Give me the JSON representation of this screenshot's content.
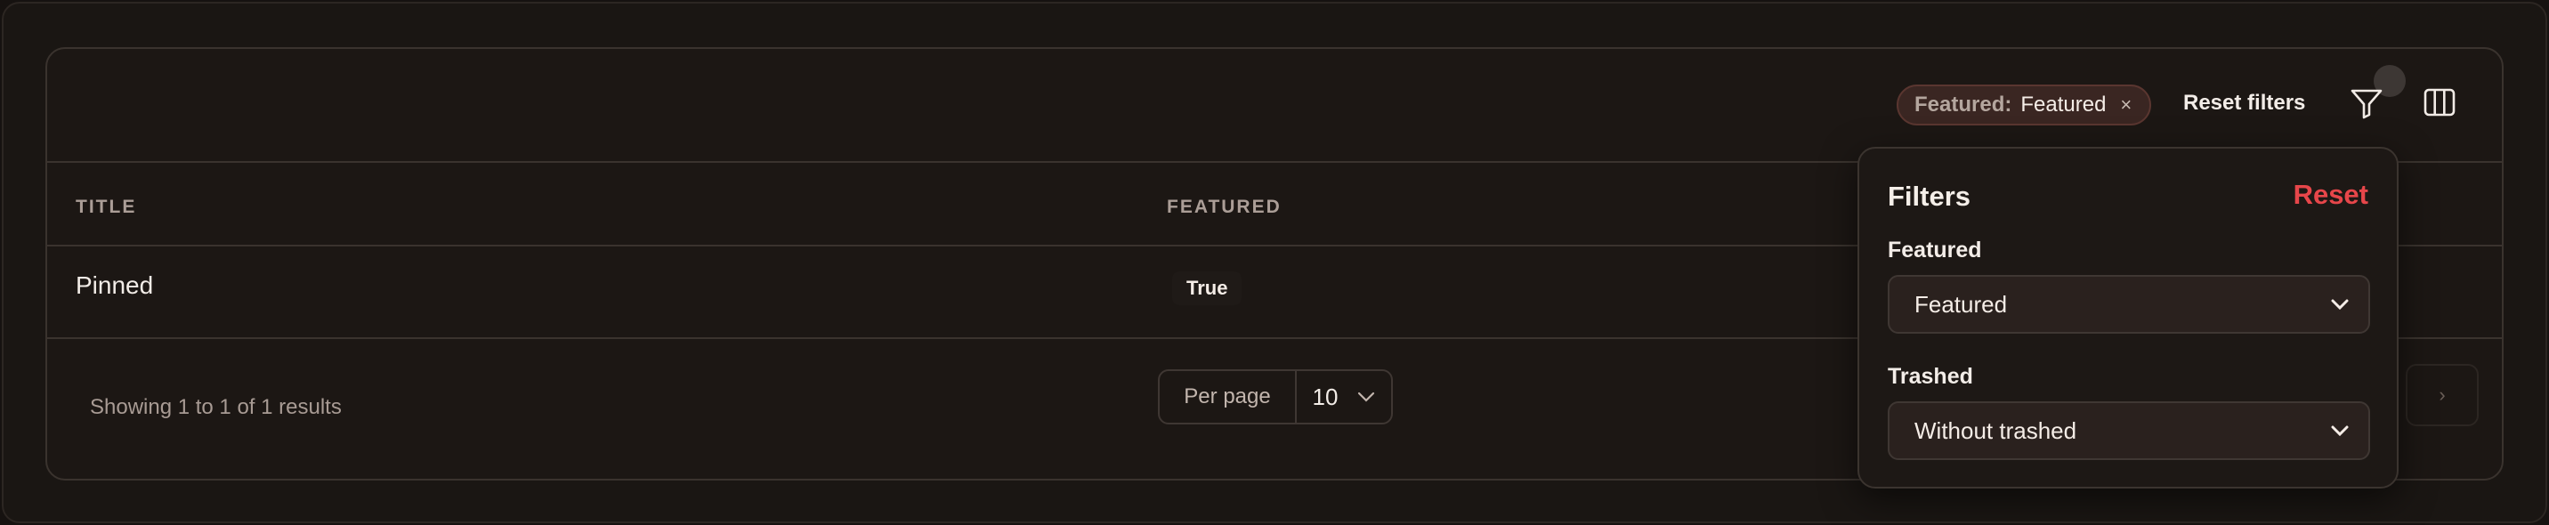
{
  "toolbar": {
    "filter_chip": {
      "key": "Featured:",
      "value": "Featured",
      "remove_glyph": "×"
    },
    "reset_filters_label": "Reset filters",
    "filter_icon": "funnel-icon",
    "columns_icon": "columns-icon"
  },
  "table": {
    "columns": [
      "Title",
      "Featured"
    ],
    "rows": [
      {
        "title": "Pinned",
        "featured": "True"
      }
    ]
  },
  "footer": {
    "showing": "Showing 1 to 1 of 1 results",
    "per_page_label": "Per page",
    "per_page_value": "10",
    "next_glyph": "›"
  },
  "filters_panel": {
    "title": "Filters",
    "reset_label": "Reset",
    "fields": [
      {
        "label": "Featured",
        "value": "Featured"
      },
      {
        "label": "Trashed",
        "value": "Without trashed"
      }
    ]
  },
  "colors": {
    "background": "#161210",
    "card": "#1c1714",
    "reset_red": "#e7464a",
    "chip_bg": "#3a2622"
  }
}
